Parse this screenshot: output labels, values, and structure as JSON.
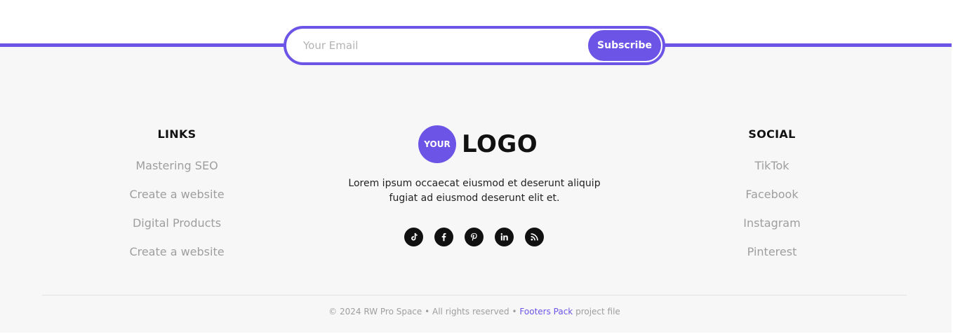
{
  "subscribe": {
    "placeholder": "Your Email",
    "value": "",
    "button_label": "Subscribe"
  },
  "links": {
    "title": "LINKS",
    "items": [
      "Mastering SEO",
      "Create a website",
      "Digital Products",
      "Create a website"
    ]
  },
  "brand": {
    "logo_badge": "YOUR",
    "logo_text": "LOGO",
    "description_line1": "Lorem ipsum occaecat eiusmod et deserunt aliquip",
    "description_line2": "fugiat ad eiusmod deserunt elit et."
  },
  "social_icons": [
    "tiktok-icon",
    "facebook-icon",
    "pinterest-icon",
    "linkedin-icon",
    "rss-icon"
  ],
  "social": {
    "title": "SOCIAL",
    "items": [
      "TikTok",
      "Facebook",
      "Instagram",
      "Pinterest"
    ]
  },
  "footer": {
    "copyright_prefix": "© 2024 RW Pro Space • All rights reserved •",
    "link_text": "Footers Pack",
    "copyright_suffix": "project file"
  },
  "colors": {
    "accent": "#6c55e6",
    "background": "#f7f7f7",
    "muted_text": "#9e9e9e"
  }
}
